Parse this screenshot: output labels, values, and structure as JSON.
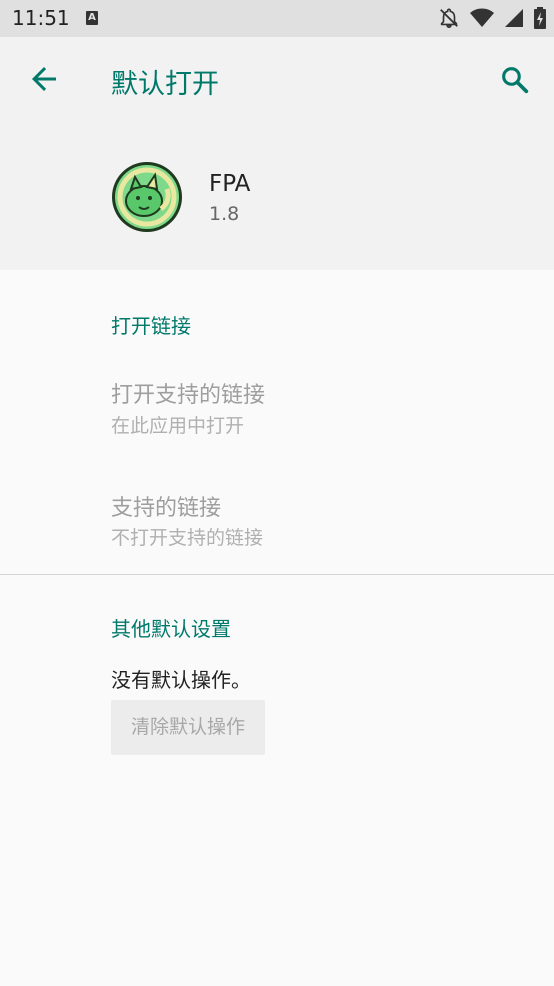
{
  "status_bar": {
    "time": "11:51",
    "a_badge": "A",
    "icons": [
      "notification-off-icon",
      "wifi-icon",
      "cell-signal-icon",
      "battery-charging-icon"
    ]
  },
  "app_bar": {
    "title": "默认打开",
    "back_icon": "arrow-back-icon",
    "search_icon": "search-icon",
    "accent": "#00796b"
  },
  "app": {
    "name": "FPA",
    "version": "1.8"
  },
  "open_links": {
    "header": "打开链接",
    "open_supported": {
      "title": "打开支持的链接",
      "summary": "在此应用中打开"
    },
    "supported_links": {
      "title": "支持的链接",
      "summary": "不打开支持的链接"
    }
  },
  "other_defaults": {
    "header": "其他默认设置",
    "message": "没有默认操作。",
    "clear_button": "清除默认操作"
  }
}
